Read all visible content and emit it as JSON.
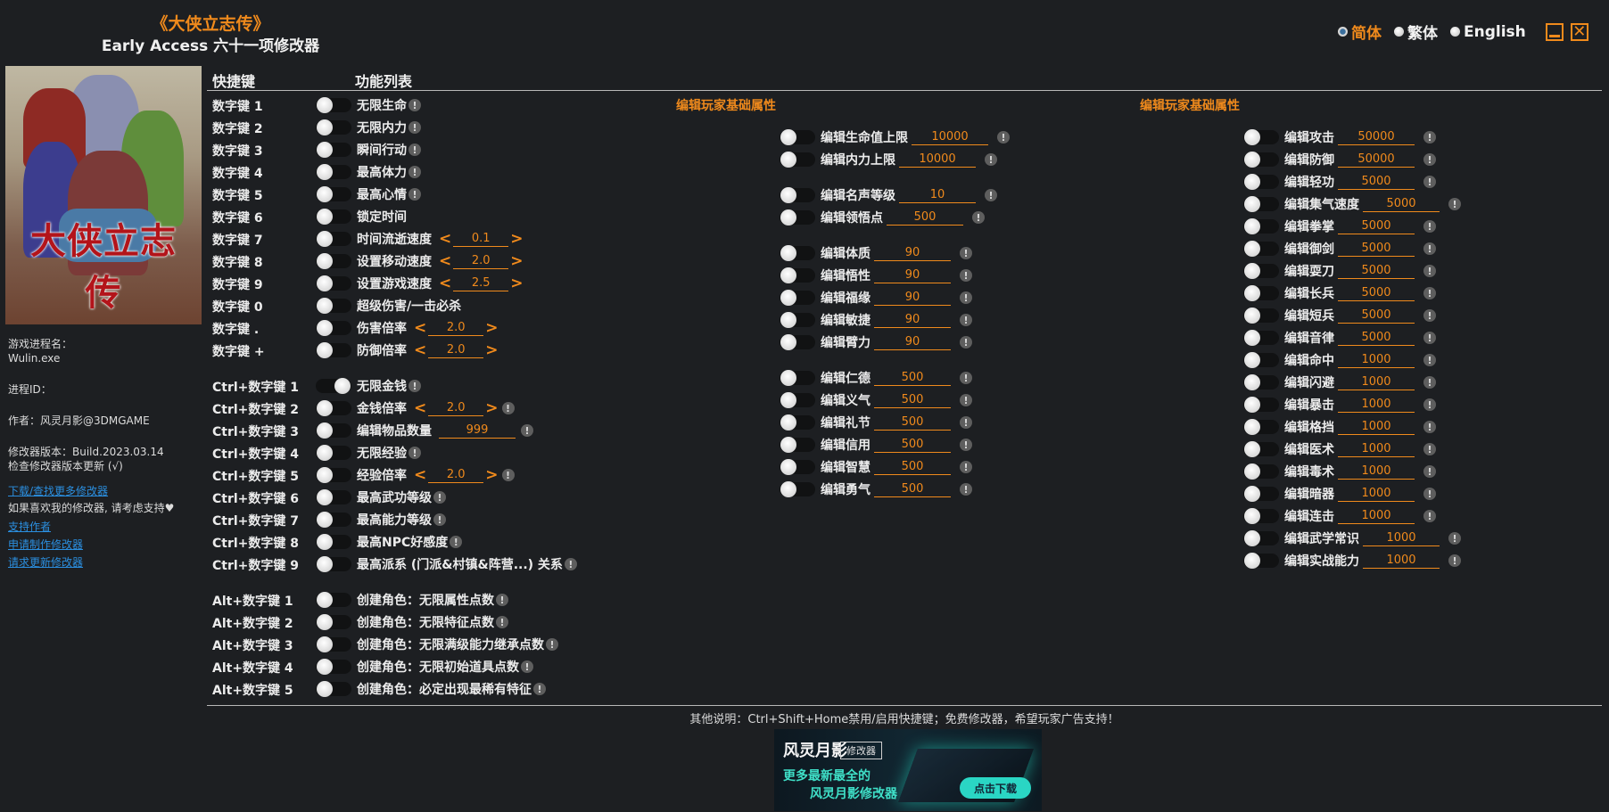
{
  "header": {
    "title": "《大侠立志传》",
    "subtitle": "Early Access 六十一项修改器"
  },
  "languages": [
    {
      "label": "简体",
      "selected": true
    },
    {
      "label": "繁体",
      "selected": false
    },
    {
      "label": "English",
      "selected": false
    }
  ],
  "window": {
    "minimize": "minimize",
    "close": "✕"
  },
  "cover": {
    "title": "大侠立志传"
  },
  "info": {
    "process_label": "游戏进程名：",
    "process_value": "Wulin.exe",
    "pid_label": "进程ID：",
    "author": "作者：风灵月影@3DMGAME",
    "version": "修改器版本：Build.2023.03.14",
    "check_update": "检查修改器版本更新 (√)",
    "download_more": "下载/查找更多修改器",
    "support_text": "如果喜欢我的修改器, 请考虑支持♥",
    "support_author": "支持作者",
    "request_make": "申请制作修改器",
    "request_update": "请求更新修改器"
  },
  "columns": {
    "hotkey": "快捷键",
    "features": "功能列表"
  },
  "hotkeys": [
    {
      "key": "数字键 1",
      "label": "无限生命",
      "on": false,
      "info": true
    },
    {
      "key": "数字键 2",
      "label": "无限内力",
      "on": false,
      "info": true
    },
    {
      "key": "数字键 3",
      "label": "瞬间行动",
      "on": false,
      "info": true
    },
    {
      "key": "数字键 4",
      "label": "最高体力",
      "on": false,
      "info": true
    },
    {
      "key": "数字键 5",
      "label": "最高心情",
      "on": false,
      "info": true
    },
    {
      "key": "数字键 6",
      "label": "锁定时间",
      "on": false,
      "info": false
    },
    {
      "key": "数字键 7",
      "label": "时间流逝速度",
      "on": false,
      "stepper": "0.1"
    },
    {
      "key": "数字键 8",
      "label": "设置移动速度",
      "on": false,
      "stepper": "2.0"
    },
    {
      "key": "数字键 9",
      "label": "设置游戏速度",
      "on": false,
      "stepper": "2.5"
    },
    {
      "key": "数字键 0",
      "label": "超级伤害/一击必杀",
      "on": false,
      "info": false
    },
    {
      "key": "数字键 .",
      "label": "伤害倍率",
      "on": false,
      "stepper": "2.0"
    },
    {
      "key": "数字键 +",
      "label": "防御倍率",
      "on": false,
      "stepper": "2.0"
    }
  ],
  "ctrl_hotkeys": [
    {
      "key": "Ctrl+数字键 1",
      "label": "无限金钱",
      "on": true,
      "info": true
    },
    {
      "key": "Ctrl+数字键 2",
      "label": "金钱倍率",
      "on": false,
      "stepper": "2.0",
      "info": true
    },
    {
      "key": "Ctrl+数字键 3",
      "label": "编辑物品数量",
      "on": false,
      "input": "999",
      "info": true
    },
    {
      "key": "Ctrl+数字键 4",
      "label": "无限经验",
      "on": false,
      "info": true
    },
    {
      "key": "Ctrl+数字键 5",
      "label": "经验倍率",
      "on": false,
      "stepper": "2.0",
      "info": true
    },
    {
      "key": "Ctrl+数字键 6",
      "label": "最高武功等级",
      "on": false,
      "info": true
    },
    {
      "key": "Ctrl+数字键 7",
      "label": "最高能力等级",
      "on": false,
      "info": true
    },
    {
      "key": "Ctrl+数字键 8",
      "label": "最高NPC好感度",
      "on": false,
      "info": true
    },
    {
      "key": "Ctrl+数字键 9",
      "label": "最高派系 (门派&村镇&阵营...) 关系",
      "on": false,
      "info": true
    }
  ],
  "alt_hotkeys": [
    {
      "key": "Alt+数字键 1",
      "label": "创建角色：无限属性点数",
      "on": false,
      "info": true
    },
    {
      "key": "Alt+数字键 2",
      "label": "创建角色：无限特征点数",
      "on": false,
      "info": true
    },
    {
      "key": "Alt+数字键 3",
      "label": "创建角色：无限满级能力继承点数",
      "on": false,
      "info": true
    },
    {
      "key": "Alt+数字键 4",
      "label": "创建角色：无限初始道具点数",
      "on": false,
      "info": true
    },
    {
      "key": "Alt+数字键 5",
      "label": "创建角色：必定出现最稀有特征",
      "on": false,
      "info": true
    }
  ],
  "panel_middle": {
    "title": "编辑玩家基础属性",
    "groups": [
      [
        {
          "label": "编辑生命值上限",
          "value": "10000"
        },
        {
          "label": "编辑内力上限",
          "value": "10000"
        }
      ],
      [
        {
          "label": "编辑名声等级",
          "value": "10"
        },
        {
          "label": "编辑领悟点",
          "value": "500"
        }
      ],
      [
        {
          "label": "编辑体质",
          "value": "90"
        },
        {
          "label": "编辑悟性",
          "value": "90"
        },
        {
          "label": "编辑福缘",
          "value": "90"
        },
        {
          "label": "编辑敏捷",
          "value": "90"
        },
        {
          "label": "编辑臂力",
          "value": "90"
        }
      ],
      [
        {
          "label": "编辑仁德",
          "value": "500"
        },
        {
          "label": "编辑义气",
          "value": "500"
        },
        {
          "label": "编辑礼节",
          "value": "500"
        },
        {
          "label": "编辑信用",
          "value": "500"
        },
        {
          "label": "编辑智慧",
          "value": "500"
        },
        {
          "label": "编辑勇气",
          "value": "500"
        }
      ]
    ]
  },
  "panel_right": {
    "title": "编辑玩家基础属性",
    "items": [
      {
        "label": "编辑攻击",
        "value": "50000"
      },
      {
        "label": "编辑防御",
        "value": "50000"
      },
      {
        "label": "编辑轻功",
        "value": "5000"
      },
      {
        "label": "编辑集气速度",
        "value": "5000"
      },
      {
        "label": "编辑拳掌",
        "value": "5000"
      },
      {
        "label": "编辑御剑",
        "value": "5000"
      },
      {
        "label": "编辑耍刀",
        "value": "5000"
      },
      {
        "label": "编辑长兵",
        "value": "5000"
      },
      {
        "label": "编辑短兵",
        "value": "5000"
      },
      {
        "label": "编辑音律",
        "value": "5000"
      },
      {
        "label": "编辑命中",
        "value": "1000"
      },
      {
        "label": "编辑闪避",
        "value": "1000"
      },
      {
        "label": "编辑暴击",
        "value": "1000"
      },
      {
        "label": "编辑格挡",
        "value": "1000"
      },
      {
        "label": "编辑医术",
        "value": "1000"
      },
      {
        "label": "编辑毒术",
        "value": "1000"
      },
      {
        "label": "编辑暗器",
        "value": "1000"
      },
      {
        "label": "编辑连击",
        "value": "1000"
      },
      {
        "label": "编辑武学常识",
        "value": "1000"
      },
      {
        "label": "编辑实战能力",
        "value": "1000"
      }
    ]
  },
  "footer": {
    "note": "其他说明：Ctrl+Shift+Home禁用/启用快捷键；免费修改器，希望玩家广告支持！",
    "banner": {
      "logo": "风灵月影",
      "tag": "修改器",
      "line1": "更多最新最全的",
      "line2": "风灵月影修改器",
      "download": "点击下载"
    }
  },
  "colors": {
    "accent": "#f08a1c",
    "background": "#1d1f22",
    "link": "#2b8fe0"
  }
}
